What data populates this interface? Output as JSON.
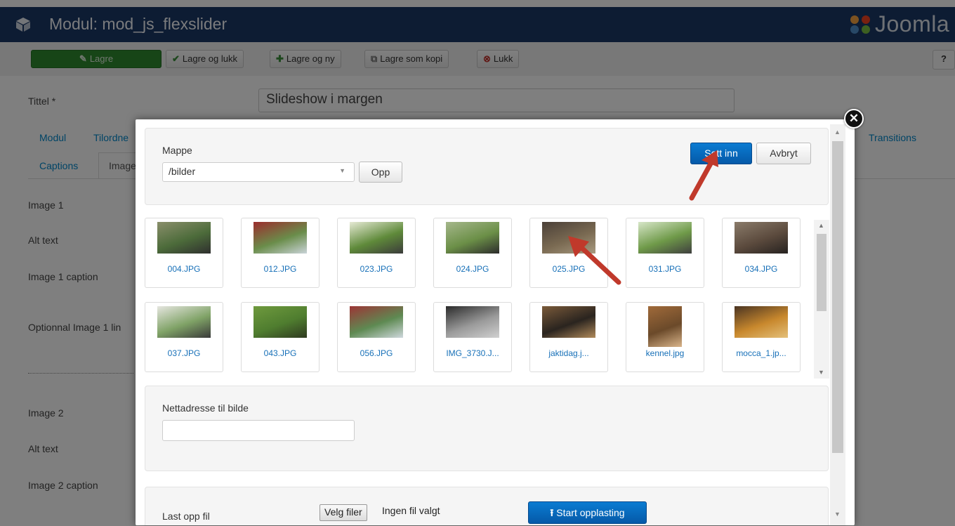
{
  "header": {
    "title": "Modul: mod_js_flexslider",
    "brand": "Joomla"
  },
  "toolbar": {
    "save": "Lagre",
    "save_close": "Lagre og lukk",
    "save_new": "Lagre og ny",
    "save_copy": "Lagre som kopi",
    "close": "Lukk",
    "help_glyph": "?"
  },
  "form": {
    "title_label": "Tittel *",
    "title_value": "Slideshow i margen",
    "tabs": [
      "Modul",
      "Tilordne",
      "Transitions",
      "Captions",
      "Image"
    ],
    "fields": [
      "Image 1",
      "Alt text",
      "Image 1 caption",
      "Optionnal Image 1 lin",
      "Image 2",
      "Alt text",
      "Image 2 caption"
    ]
  },
  "modal": {
    "close_glyph": "✕",
    "folder_label": "Mappe",
    "folder_value": "/bilder",
    "up_button": "Opp",
    "insert_button": "Sett inn",
    "cancel_button": "Avbryt",
    "thumbnails": [
      {
        "name": "004.JPG"
      },
      {
        "name": "012.JPG"
      },
      {
        "name": "023.JPG"
      },
      {
        "name": "024.JPG"
      },
      {
        "name": "025.JPG"
      },
      {
        "name": "031.JPG"
      },
      {
        "name": "034.JPG"
      },
      {
        "name": "037.JPG"
      },
      {
        "name": "043.JPG"
      },
      {
        "name": "056.JPG"
      },
      {
        "name": "IMG_3730.J..."
      },
      {
        "name": "jaktidag.j..."
      },
      {
        "name": "kennel.jpg"
      },
      {
        "name": "mocca_1.jp..."
      }
    ],
    "url_label": "Nettadresse til bilde",
    "url_value": "",
    "upload_label": "Last opp fil",
    "choose_files": "Velg filer",
    "no_file": "Ingen fil valgt",
    "start_upload": "Start opplasting"
  },
  "colors": {
    "topbar": "#1a3867",
    "primary": "#0a6bc4",
    "annotation_arrow": "#c0392b",
    "link": "#1770b8"
  }
}
